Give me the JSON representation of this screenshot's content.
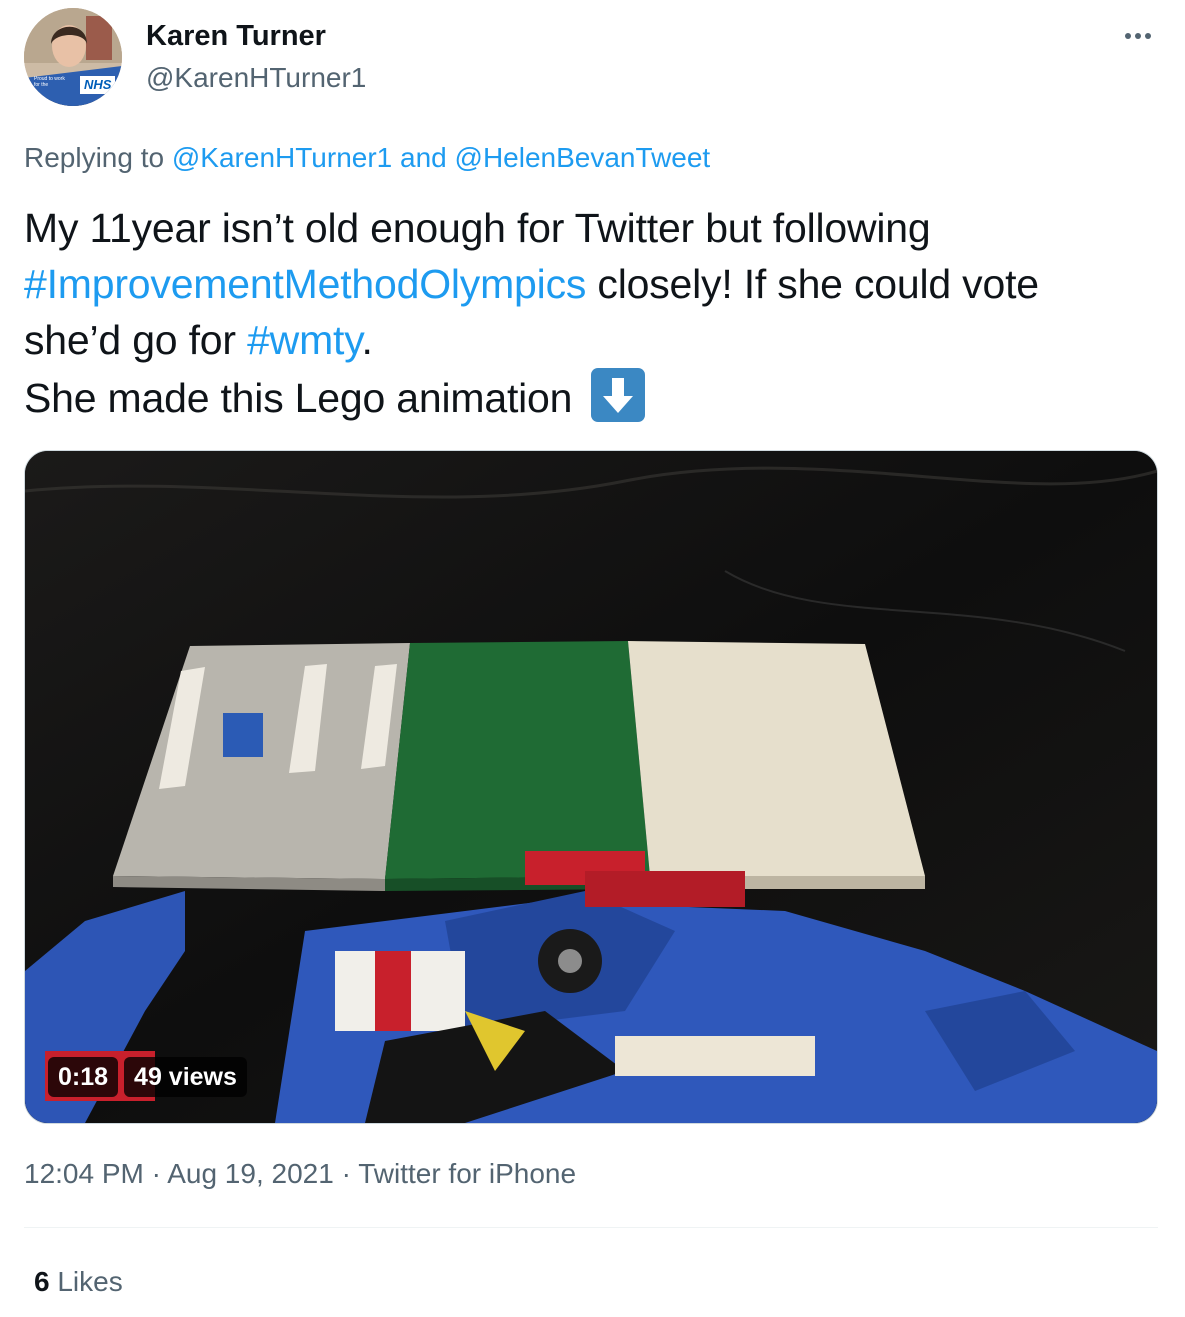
{
  "author": {
    "name": "Karen Turner",
    "handle": "@KarenHTurner1",
    "avatar_badge": "NHS",
    "avatar_caption": "Proud to work for the"
  },
  "reply": {
    "prefix": "Replying to",
    "user1": "@KarenHTurner1",
    "conj": "and",
    "user2": "@HelenBevanTweet"
  },
  "tweet": {
    "line1": "My 11year isn’t old enough for Twitter but following",
    "hashtag1": "#ImprovementMethodOlympics",
    "line2_rest": "closely! If she could vote",
    "line3_start": "she’d go for",
    "hashtag2": "#wmty",
    "line3_end": ".",
    "line4": "She made this Lego animation",
    "emoji": "down-arrow-emoji"
  },
  "video": {
    "duration": "0:18",
    "views": "49 views"
  },
  "meta": {
    "time": "12:04 PM",
    "sep1": "·",
    "date": "Aug 19, 2021",
    "sep2": "·",
    "source": "Twitter for iPhone"
  },
  "stats": {
    "likes_count": "6",
    "likes_label": "Likes"
  },
  "colors": {
    "link": "#1d9bf0",
    "secondary_text": "#536471",
    "primary_text": "#0f1419",
    "emoji_blue": "#3b88c3"
  }
}
